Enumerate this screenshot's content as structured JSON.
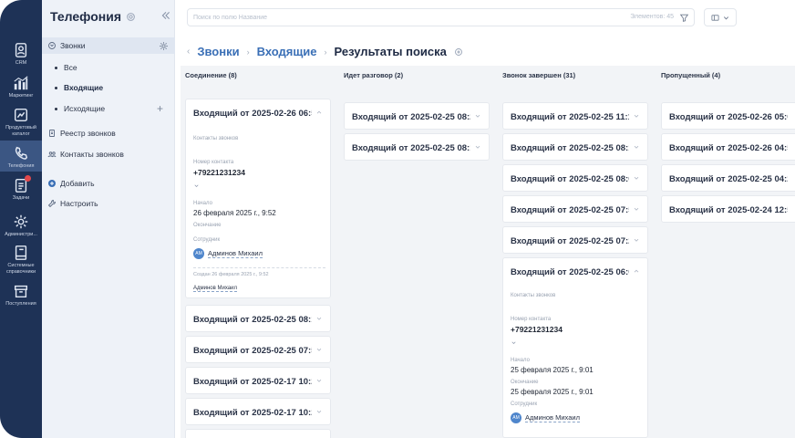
{
  "rail": {
    "items": [
      {
        "label": "CRM",
        "icon": "crm-icon"
      },
      {
        "label": "Маркетинг",
        "icon": "chart-icon"
      },
      {
        "label": "Продуктовый каталог",
        "icon": "catalog-icon"
      },
      {
        "label": "Телефония",
        "icon": "phone-icon"
      },
      {
        "label": "Задачи",
        "icon": "tasks-icon"
      },
      {
        "label": "Администри...",
        "icon": "gear-icon"
      },
      {
        "label": "Системные справочники",
        "icon": "book-icon"
      },
      {
        "label": "Поступления",
        "icon": "inbox-icon"
      }
    ]
  },
  "sidebar": {
    "title": "Телефония",
    "calls_label": "Звонки",
    "sub_items": [
      "Все",
      "Входящие",
      "Исходящие"
    ],
    "registry_label": "Реестр звонков",
    "contacts_label": "Контакты звонков",
    "add_label": "Добавить",
    "settings_label": "Настроить"
  },
  "search": {
    "placeholder": "Поиск по полю Название",
    "count_label": "Элементов: 45"
  },
  "breadcrumb": {
    "items": [
      "Звонки",
      "Входящие"
    ],
    "current": "Результаты поиска"
  },
  "board": {
    "columns": [
      {
        "title": "Соединение (8)",
        "cards": [
          {
            "title": "Входящий от 2025-02-26 06:5...",
            "expanded": true
          },
          {
            "title": "Входящий от 2025-02-25 08:1..."
          },
          {
            "title": "Входящий от 2025-02-25 07:5..."
          },
          {
            "title": "Входящий от 2025-02-17 10:2..."
          },
          {
            "title": "Входящий от 2025-02-17 10:2..."
          }
        ]
      },
      {
        "title": "Идет разговор (2)",
        "cards": [
          {
            "title": "Входящий от 2025-02-25 08:2..."
          },
          {
            "title": "Входящий от 2025-02-25 08:1..."
          }
        ]
      },
      {
        "title": "Звонок завершен (31)",
        "cards": [
          {
            "title": "Входящий от 2025-02-25 11:1..."
          },
          {
            "title": "Входящий от 2025-02-25 08:1..."
          },
          {
            "title": "Входящий от 2025-02-25 08:0..."
          },
          {
            "title": "Входящий от 2025-02-25 07:5..."
          },
          {
            "title": "Входящий от 2025-02-25 07:2..."
          },
          {
            "title": "Входящий от 2025-02-25 06:0...",
            "expanded": true
          }
        ]
      },
      {
        "title": "Пропущенный (4)",
        "cards": [
          {
            "title": "Входящий от 2025-02-26 05:0..."
          },
          {
            "title": "Входящий от 2025-02-26 04:5..."
          },
          {
            "title": "Входящий от 2025-02-25 04:2..."
          },
          {
            "title": "Входящий от 2025-02-24 12:5..."
          }
        ]
      }
    ],
    "detail_a": {
      "contacts_label": "Контакты звонков",
      "number_label": "Номер контакта",
      "number": "+79221231234",
      "start_label": "Начало",
      "start": "26 февраля 2025 г., 9:52",
      "end_label": "Окончание",
      "employee_label": "Сотрудник",
      "employee_initials": "AM",
      "employee": "Админов Михаил",
      "created": "Создан  26 февраля 2025 г., 9:52",
      "created_by": "Админов Михаил"
    },
    "detail_b": {
      "contacts_label": "Контакты звонков",
      "number_label": "Номер контакта",
      "number": "+79221231234",
      "start_label": "Начало",
      "start": "25 февраля 2025 г., 9:01",
      "end_label": "Окончание",
      "end": "25 февраля 2025 г., 9:01",
      "employee_label": "Сотрудник",
      "employee_initials": "AM",
      "employee": "Админов Михаил"
    }
  }
}
